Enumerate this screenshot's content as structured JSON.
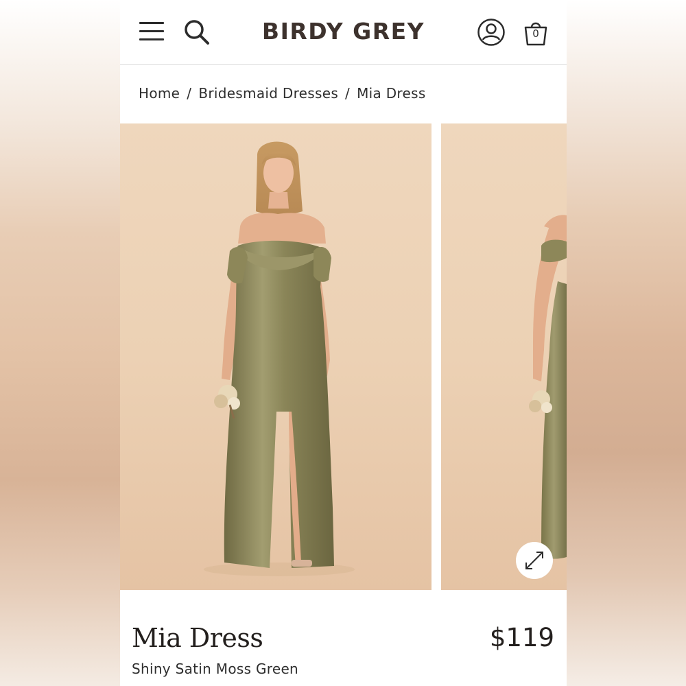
{
  "header": {
    "logo": "BIRDY GREY",
    "bag_count": "0",
    "icons": [
      "menu-icon",
      "search-icon",
      "account-icon",
      "shopping-bag-icon"
    ]
  },
  "breadcrumb": {
    "items": [
      "Home",
      "Bridesmaid Dresses",
      "Mia Dress"
    ],
    "separator": "/"
  },
  "gallery": {
    "images": [
      "model-front-photo",
      "model-side-photo"
    ],
    "expand_icon": "expand-icon"
  },
  "product": {
    "title": "Mia Dress",
    "price": "$119",
    "variant": "Shiny Satin Moss Green"
  },
  "colors": {
    "dress": "#857f54",
    "backdrop": "#ecd1b4",
    "text": "#231f1d",
    "logo": "#3d322d"
  }
}
